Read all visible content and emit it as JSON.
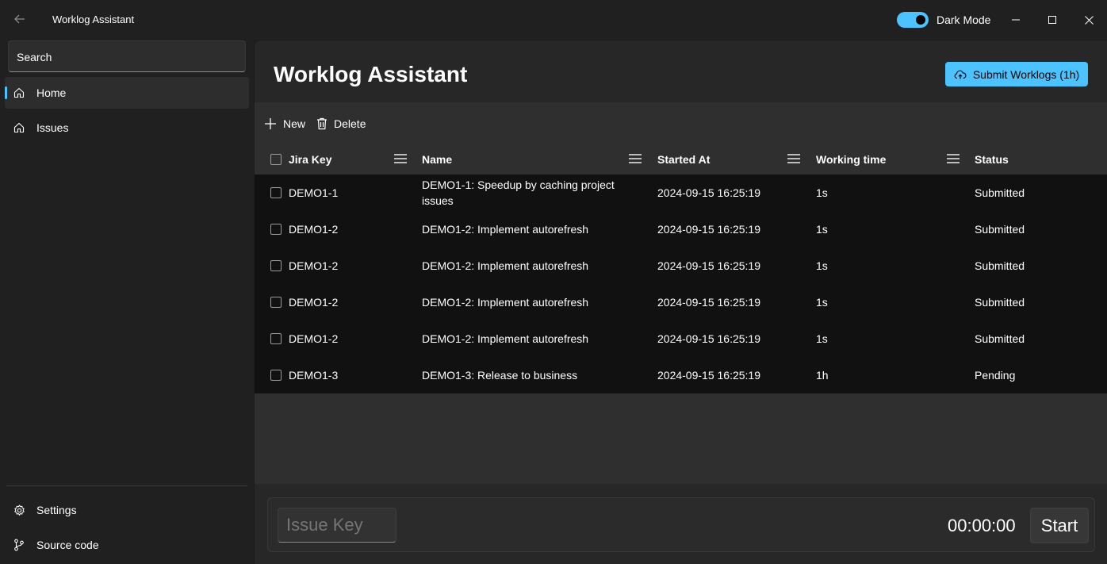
{
  "window": {
    "title": "Worklog Assistant",
    "dark_mode_label": "Dark Mode",
    "dark_mode_on": true
  },
  "sidebar": {
    "search_placeholder": "Search",
    "items": [
      {
        "label": "Home",
        "icon": "home-icon",
        "active": true
      },
      {
        "label": "Issues",
        "icon": "home-icon",
        "active": false
      }
    ],
    "footer_items": [
      {
        "label": "Settings",
        "icon": "gear-icon"
      },
      {
        "label": "Source code",
        "icon": "git-branch-icon"
      }
    ]
  },
  "main": {
    "title": "Worklog Assistant",
    "submit_label": "Submit Worklogs (1h)",
    "toolbar": {
      "new_label": "New",
      "delete_label": "Delete"
    },
    "columns": [
      "Jira Key",
      "Name",
      "Started At",
      "Working time",
      "Status"
    ],
    "rows": [
      {
        "key": "DEMO1-1",
        "name": "DEMO1-1: Speedup by caching project issues",
        "started": "2024-09-15 16:25:19",
        "time": "1s",
        "status": "Submitted"
      },
      {
        "key": "DEMO1-2",
        "name": "DEMO1-2: Implement autorefresh",
        "started": "2024-09-15 16:25:19",
        "time": "1s",
        "status": "Submitted"
      },
      {
        "key": "DEMO1-2",
        "name": "DEMO1-2: Implement autorefresh",
        "started": "2024-09-15 16:25:19",
        "time": "1s",
        "status": "Submitted"
      },
      {
        "key": "DEMO1-2",
        "name": "DEMO1-2: Implement autorefresh",
        "started": "2024-09-15 16:25:19",
        "time": "1s",
        "status": "Submitted"
      },
      {
        "key": "DEMO1-2",
        "name": "DEMO1-2: Implement autorefresh",
        "started": "2024-09-15 16:25:19",
        "time": "1s",
        "status": "Submitted"
      },
      {
        "key": "DEMO1-3",
        "name": "DEMO1-3: Release to business",
        "started": "2024-09-15 16:25:19",
        "time": "1h",
        "status": "Pending"
      }
    ],
    "footer": {
      "issue_key_placeholder": "Issue Key",
      "timer": "00:00:00",
      "start_label": "Start"
    }
  },
  "colors": {
    "accent": "#4cc2ff",
    "background": "#202020",
    "grid_rows": "#111111"
  }
}
